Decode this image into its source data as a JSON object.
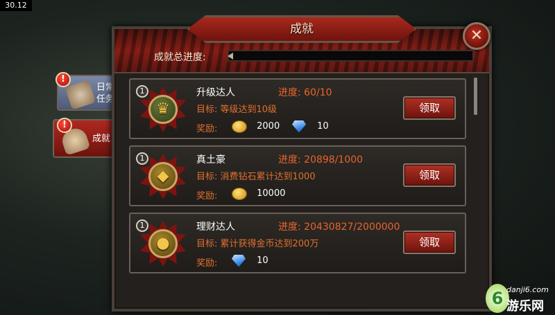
{
  "fps": "30.12",
  "title": "成就",
  "close_icon": "close-x-icon",
  "total": {
    "label": "成就总进度:",
    "progress_fraction": 0.0
  },
  "tabs": [
    {
      "label": "日常\n任务",
      "icon": "scroll-icon",
      "alert": "!",
      "active": false
    },
    {
      "label": "成就",
      "icon": "trophy-icon",
      "alert": "!",
      "active": true
    }
  ],
  "achievements": [
    {
      "rank": "1",
      "name": "升级达人",
      "progress": "进度: 60/10",
      "goal": "目标: 等级达到10级",
      "reward_label": "奖励:",
      "rewards": [
        {
          "icon": "gold-coin-icon",
          "amount": "2000"
        },
        {
          "icon": "diamond-icon",
          "amount": "10"
        }
      ],
      "claim_label": "领取",
      "emblem_icon": "level-up-emblem-icon"
    },
    {
      "rank": "1",
      "name": "真土豪",
      "progress": "进度: 20898/1000",
      "goal": "目标: 消费钻石累计达到1000",
      "reward_label": "奖励:",
      "rewards": [
        {
          "icon": "gold-coin-icon",
          "amount": "10000"
        }
      ],
      "claim_label": "领取",
      "emblem_icon": "diamond-emblem-icon"
    },
    {
      "rank": "1",
      "name": "理财达人",
      "progress": "进度: 20430827/2000000",
      "goal": "目标: 累计获得金币达到200万",
      "reward_label": "奖励:",
      "rewards": [
        {
          "icon": "diamond-icon",
          "amount": "10"
        }
      ],
      "claim_label": "领取",
      "emblem_icon": "coin-stack-emblem-icon"
    }
  ],
  "watermark": {
    "logo": "6",
    "url": "danji6.com",
    "name": "游乐网"
  },
  "colors": {
    "accent_red": "#a8281c",
    "progress_orange": "#e8642c",
    "goal_orange": "#e07030"
  }
}
